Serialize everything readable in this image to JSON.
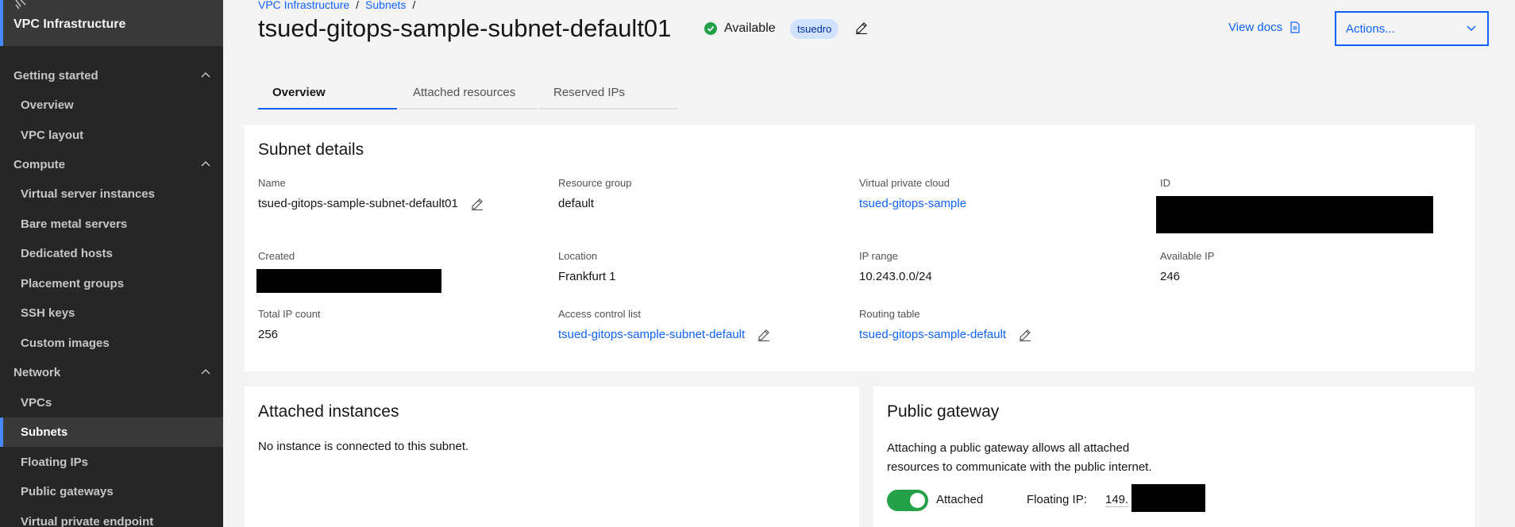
{
  "sidebar": {
    "title": "VPC Infrastructure",
    "sections": [
      {
        "label": "Getting started",
        "items": [
          "Overview",
          "VPC layout"
        ]
      },
      {
        "label": "Compute",
        "items": [
          "Virtual server instances",
          "Bare metal servers",
          "Dedicated hosts",
          "Placement groups",
          "SSH keys",
          "Custom images"
        ]
      },
      {
        "label": "Network",
        "items": [
          "VPCs",
          "Subnets",
          "Floating IPs",
          "Public gateways",
          "Virtual private endpoint"
        ]
      }
    ],
    "active_item": "Subnets"
  },
  "breadcrumb": [
    "VPC Infrastructure",
    "Subnets"
  ],
  "header": {
    "title": "tsued-gitops-sample-subnet-default01",
    "status": "Available",
    "tag": "tsuedro",
    "view_docs": "View docs",
    "actions": "Actions..."
  },
  "tabs": [
    "Overview",
    "Attached resources",
    "Reserved IPs"
  ],
  "details": {
    "title": "Subnet details",
    "name_label": "Name",
    "name_value": "tsued-gitops-sample-subnet-default01",
    "rg_label": "Resource group",
    "rg_value": "default",
    "vpc_label": "Virtual private cloud",
    "vpc_value": "tsued-gitops-sample",
    "id_label": "ID",
    "created_label": "Created",
    "location_label": "Location",
    "location_value": "Frankfurt 1",
    "ip_range_label": "IP range",
    "ip_range_value": "10.243.0.0/24",
    "avail_ip_label": "Available IP",
    "avail_ip_value": "246",
    "total_ip_label": "Total IP count",
    "total_ip_value": "256",
    "acl_label": "Access control list",
    "acl_value": "tsued-gitops-sample-subnet-default",
    "routing_label": "Routing table",
    "routing_value": "tsued-gitops-sample-default"
  },
  "instances": {
    "title": "Attached instances",
    "text": "No instance is connected to this subnet."
  },
  "gateway": {
    "title": "Public gateway",
    "text_line1": "Attaching a public gateway allows all attached",
    "text_line2": "resources to communicate with the public internet.",
    "toggle_label": "Attached",
    "floating_ip_label": "Floating IP:",
    "floating_ip_value": "149."
  },
  "colors": {
    "accent": "#0f62fe",
    "success": "#24a148",
    "sidebar_bg": "#262626"
  }
}
